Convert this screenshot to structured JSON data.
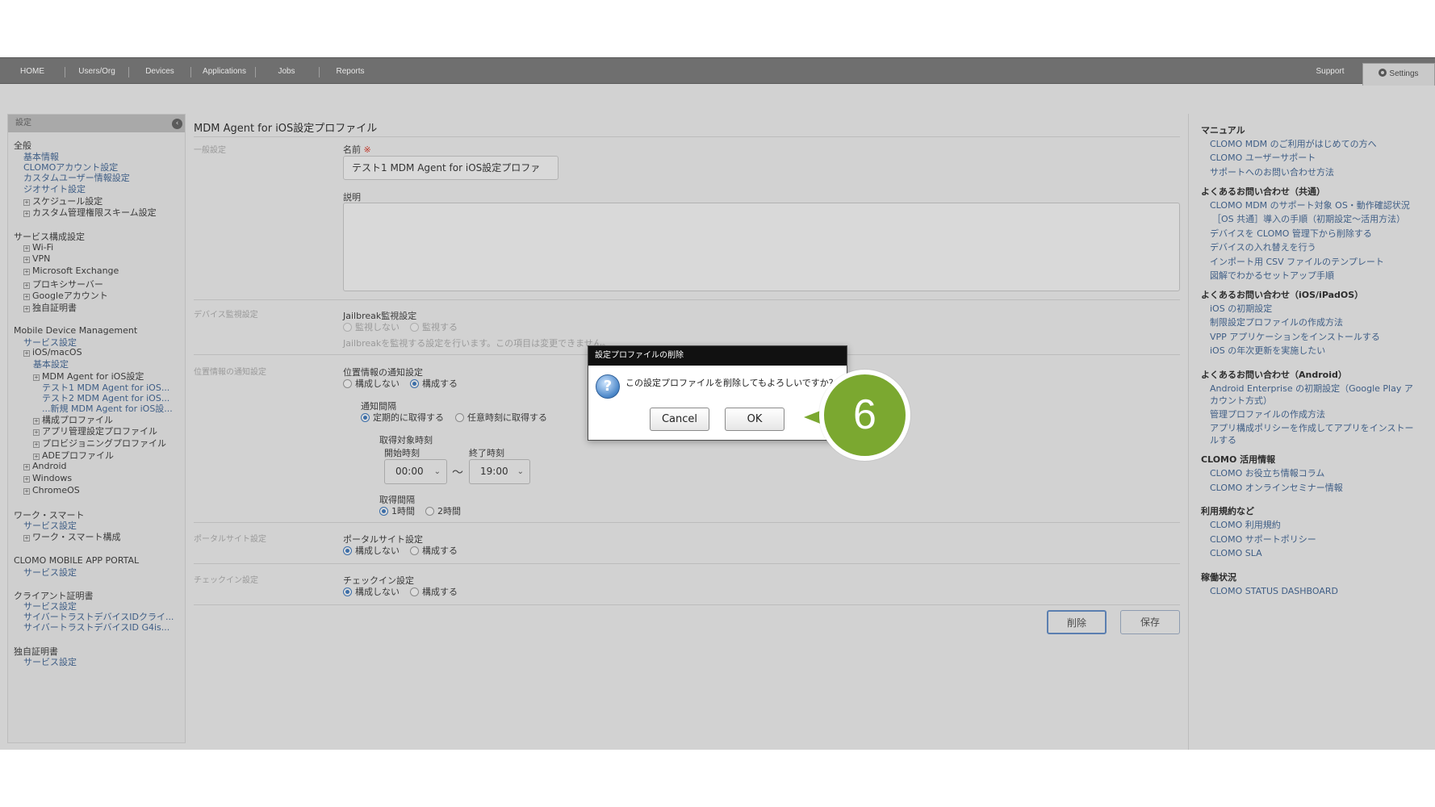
{
  "nav": {
    "tabs": [
      "HOME",
      "Users/Org",
      "Devices",
      "Applications",
      "Jobs",
      "Reports"
    ],
    "support": "Support",
    "settings": "Settings"
  },
  "sidebar": {
    "header": "設定",
    "collapse_glyph": "‹",
    "items": [
      {
        "label": "全般",
        "kind": "head"
      },
      {
        "label": "基本情報",
        "kind": "link"
      },
      {
        "label": "CLOMOアカウント設定",
        "kind": "link"
      },
      {
        "label": "カスタムユーザー情報設定",
        "kind": "link"
      },
      {
        "label": "ジオサイト設定",
        "kind": "link"
      },
      {
        "label": "スケジュール設定",
        "kind": "expand"
      },
      {
        "label": "カスタム管理権限スキーム設定",
        "kind": "expand"
      },
      {
        "label": "サービス構成設定",
        "kind": "head"
      },
      {
        "label": "Wi-Fi",
        "kind": "expand"
      },
      {
        "label": "VPN",
        "kind": "expand"
      },
      {
        "label": "Microsoft Exchange",
        "kind": "expand"
      },
      {
        "label": "プロキシサーバー",
        "kind": "expand"
      },
      {
        "label": "Googleアカウント",
        "kind": "expand"
      },
      {
        "label": "独自証明書",
        "kind": "expand"
      },
      {
        "label": "Mobile Device Management",
        "kind": "head"
      },
      {
        "label": "サービス設定",
        "kind": "link"
      },
      {
        "label": "iOS/macOS",
        "kind": "expand"
      },
      {
        "label": "基本設定",
        "kind": "link"
      },
      {
        "label": "MDM Agent for iOS設定",
        "kind": "expand"
      },
      {
        "label": "テスト1 MDM Agent for iOS...",
        "kind": "link"
      },
      {
        "label": "テスト2 MDM Agent for iOS...",
        "kind": "link"
      },
      {
        "label": "...新規 MDM Agent for iOS設...",
        "kind": "link"
      },
      {
        "label": "構成プロファイル",
        "kind": "expand"
      },
      {
        "label": "アプリ管理設定プロファイル",
        "kind": "expand"
      },
      {
        "label": "プロビジョニングプロファイル",
        "kind": "expand"
      },
      {
        "label": "ADEプロファイル",
        "kind": "expand"
      },
      {
        "label": "Android",
        "kind": "expand"
      },
      {
        "label": "Windows",
        "kind": "expand"
      },
      {
        "label": "ChromeOS",
        "kind": "expand"
      },
      {
        "label": "ワーク・スマート",
        "kind": "head"
      },
      {
        "label": "サービス設定",
        "kind": "link"
      },
      {
        "label": "ワーク・スマート構成",
        "kind": "expand"
      },
      {
        "label": "CLOMO MOBILE APP PORTAL",
        "kind": "head"
      },
      {
        "label": "サービス設定",
        "kind": "link"
      },
      {
        "label": "クライアント証明書",
        "kind": "head"
      },
      {
        "label": "サービス設定",
        "kind": "link"
      },
      {
        "label": "サイバートラストデバイスIDクライ...",
        "kind": "link"
      },
      {
        "label": "サイバートラストデバイスID G4is...",
        "kind": "link"
      },
      {
        "label": "独自証明書",
        "kind": "head"
      },
      {
        "label": "サービス設定",
        "kind": "link"
      }
    ]
  },
  "main": {
    "title": "MDM Agent for iOS設定プロファイル",
    "general": {
      "section": "一般設定",
      "name_label": "名前",
      "required_mark": "※",
      "name_value": "テスト1  MDM Agent for iOS設定プロファ",
      "desc_label": "説明",
      "desc_value": ""
    },
    "device_monitor": {
      "section": "デバイス監視設定",
      "label": "Jailbreak監視設定",
      "opt_off": "監視しない",
      "opt_on": "監視する",
      "note": "Jailbreakを監視する設定を行います。この項目は変更できません。"
    },
    "location": {
      "section": "位置情報の通知設定",
      "label": "位置情報の通知設定",
      "opt_off": "構成しない",
      "opt_on": "構成する",
      "interval_label": "通知間隔",
      "interval_opt1": "定期的に取得する",
      "interval_opt2": "任意時刻に取得する",
      "target_label": "取得対象時刻",
      "start_label": "開始時刻",
      "start_value": "00:00",
      "tilde": "〜",
      "end_label": "終了時刻",
      "end_value": "19:00",
      "gap_label": "取得間隔",
      "gap_opt1": "1時間",
      "gap_opt2": "2時間"
    },
    "portal": {
      "section": "ポータルサイト設定",
      "label": "ポータルサイト設定",
      "opt_off": "構成しない",
      "opt_on": "構成する"
    },
    "checkin": {
      "section": "チェックイン設定",
      "label": "チェックイン設定",
      "opt_off": "構成しない",
      "opt_on": "構成する"
    },
    "delete_label": "削除",
    "save_label": "保存"
  },
  "right": {
    "manual": {
      "head": "マニュアル",
      "links": [
        "CLOMO MDM のご利用がはじめての方へ",
        "CLOMO ユーザーサポート",
        "サポートへのお問い合わせ方法"
      ]
    },
    "faq_common": {
      "head": "よくあるお問い合わせ（共通）",
      "links": [
        "CLOMO MDM のサポート対象 OS・動作確認状況",
        "［OS 共通］導入の手順（初期設定〜活用方法）",
        "デバイスを CLOMO 管理下から削除する",
        "デバイスの入れ替えを行う",
        "インポート用 CSV ファイルのテンプレート",
        "図解でわかるセットアップ手順"
      ]
    },
    "faq_ios": {
      "head": "よくあるお問い合わせ（iOS/iPadOS）",
      "links": [
        "iOS の初期設定",
        "制限設定プロファイルの作成方法",
        "VPP アプリケーションをインストールする",
        "iOS の年次更新を実施したい"
      ]
    },
    "faq_android": {
      "head": "よくあるお問い合わせ（Android）",
      "links": [
        "Android Enterprise の初期設定（Google Play アカウント方式）",
        "管理プロファイルの作成方法",
        "アプリ構成ポリシーを作成してアプリをインストールする"
      ]
    },
    "usage": {
      "head": "CLOMO 活用情報",
      "links": [
        "CLOMO お役立ち情報コラム",
        "CLOMO オンラインセミナー情報"
      ]
    },
    "terms": {
      "head": "利用規約など",
      "links": [
        "CLOMO 利用規約",
        "CLOMO サポートポリシー",
        "CLOMO SLA"
      ]
    },
    "status": {
      "head": "稼働状況",
      "links": [
        "CLOMO STATUS DASHBOARD"
      ]
    }
  },
  "dialog": {
    "title": "設定プロファイルの削除",
    "icon_glyph": "?",
    "message": "この設定プロファイルを削除してもよろしいですか？",
    "cancel": "Cancel",
    "ok": "OK"
  },
  "step_badge": "6",
  "colors": {
    "badge": "#7ba830",
    "link": "#3f5e86",
    "nav": "#6f6f6f"
  }
}
